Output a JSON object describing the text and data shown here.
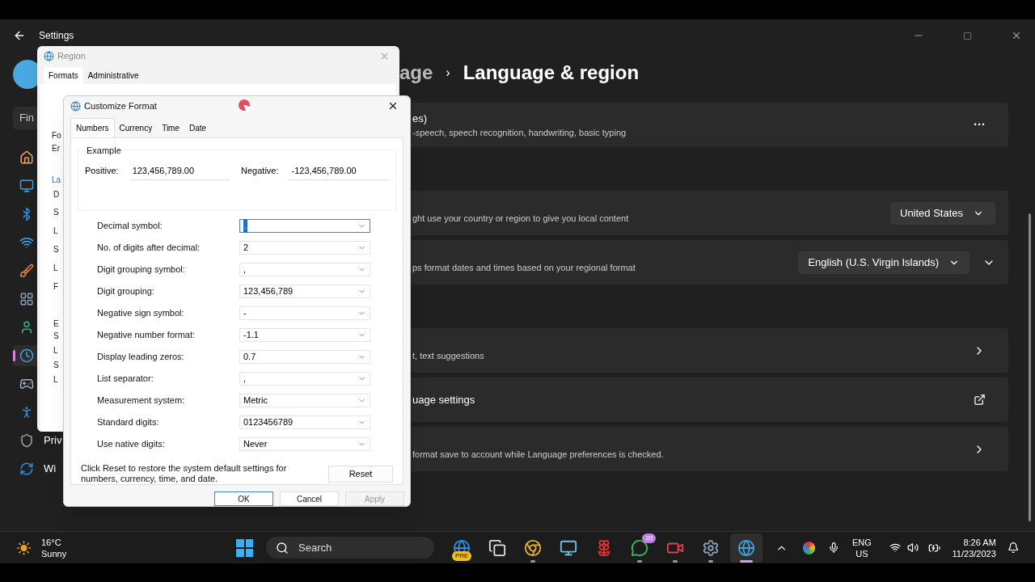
{
  "settings": {
    "title": "Settings",
    "sidebar": {
      "search": "Fin",
      "items": [
        {
          "kind": "home",
          "selected": false
        },
        {
          "kind": "system",
          "selected": false
        },
        {
          "kind": "bluetooth",
          "selected": false
        },
        {
          "kind": "network",
          "selected": false
        },
        {
          "kind": "personalization",
          "selected": false
        },
        {
          "kind": "apps",
          "selected": false
        },
        {
          "kind": "accounts",
          "selected": false
        },
        {
          "kind": "time",
          "selected": true
        },
        {
          "kind": "gaming",
          "selected": false
        },
        {
          "kind": "accessibility",
          "selected": false
        },
        {
          "kind": "privacy",
          "label": "Priv",
          "selected": false
        },
        {
          "kind": "update",
          "label": "Wi",
          "selected": false
        }
      ]
    },
    "breadcrumb": {
      "parent": "age",
      "separator": "›",
      "current": "Language & region"
    },
    "sections": [
      {
        "cards": [
          {
            "title": "es)",
            "description": "-speech, speech recognition, handwriting, basic typing",
            "action": {
              "kind": "more",
              "label": "···"
            }
          }
        ]
      },
      {
        "cards": [
          {
            "description": "ght use your country or region to give you local content",
            "action": {
              "kind": "dropdown",
              "label": "United States"
            }
          },
          {
            "description": "ps format dates and times based on your regional format",
            "action": {
              "kind": "dropdown-expand",
              "label": "English (U.S. Virgin Islands)"
            }
          }
        ]
      },
      {
        "cards": [
          {
            "description": "t, text suggestions",
            "action": {
              "kind": "chevron"
            }
          },
          {
            "title": "uage settings",
            "action": {
              "kind": "external"
            }
          },
          {
            "description": "format save to account while Language preferences is checked.",
            "action": {
              "kind": "chevron"
            }
          }
        ]
      }
    ]
  },
  "region_dialog": {
    "title": "Region",
    "tabs": [
      {
        "label": "Formats",
        "selected": true
      },
      {
        "label": "Administrative",
        "selected": false
      }
    ],
    "partial_labels": [
      {
        "text": "Fo",
        "kind": "label"
      },
      {
        "text": "Er",
        "kind": "field"
      },
      {
        "text": "La",
        "kind": "link"
      },
      {
        "text": "D",
        "kind": "label"
      },
      {
        "text": "S",
        "kind": "label"
      },
      {
        "text": "L",
        "kind": "label"
      },
      {
        "text": "S",
        "kind": "label"
      },
      {
        "text": "L",
        "kind": "label"
      },
      {
        "text": "F",
        "kind": "label"
      },
      {
        "text": "E",
        "kind": "label"
      },
      {
        "text": "S",
        "kind": "label"
      },
      {
        "text": "L",
        "kind": "label"
      },
      {
        "text": "S",
        "kind": "label"
      },
      {
        "text": "L",
        "kind": "label"
      }
    ]
  },
  "customize_dialog": {
    "title": "Customize Format",
    "tabs": [
      {
        "label": "Numbers",
        "selected": true
      },
      {
        "label": "Currency",
        "selected": false
      },
      {
        "label": "Time",
        "selected": false
      },
      {
        "label": "Date",
        "selected": false
      }
    ],
    "example": {
      "legend": "Example",
      "positive_label": "Positive:",
      "positive": "123,456,789.00",
      "negative_label": "Negative:",
      "negative": "-123,456,789.00"
    },
    "fields": [
      {
        "label": "Decimal symbol:",
        "value": ".",
        "focused": true
      },
      {
        "label": "No. of digits after decimal:",
        "value": "2",
        "focused": false
      },
      {
        "label": "Digit grouping symbol:",
        "value": ",",
        "focused": false
      },
      {
        "label": "Digit grouping:",
        "value": "123,456,789",
        "focused": false
      },
      {
        "label": "Negative sign symbol:",
        "value": "-",
        "focused": false
      },
      {
        "label": "Negative number format:",
        "value": "-1.1",
        "focused": false
      },
      {
        "label": "Display leading zeros:",
        "value": "0.7",
        "focused": false
      },
      {
        "label": "List separator:",
        "value": ",",
        "focused": false
      },
      {
        "label": "Measurement system:",
        "value": "Metric",
        "focused": false
      },
      {
        "label": "Standard digits:",
        "value": "0123456789",
        "focused": false
      },
      {
        "label": "Use native digits:",
        "value": "Never",
        "focused": false
      }
    ],
    "reset_note": "Click Reset to restore the system default settings for numbers, currency, time, and date.",
    "reset_button": "Reset",
    "buttons": [
      {
        "label": "OK",
        "default": true,
        "disabled": false
      },
      {
        "label": "Cancel",
        "default": false,
        "disabled": false
      },
      {
        "label": "Apply",
        "default": false,
        "disabled": true
      }
    ]
  },
  "taskbar": {
    "weather": {
      "temperature": "16°C",
      "condition": "Sunny"
    },
    "search_placeholder": "Search",
    "apps": [
      {
        "kind": "browser",
        "badge": "PRE",
        "running": false,
        "selected": false
      },
      {
        "kind": "taskview",
        "running": false,
        "selected": false
      },
      {
        "kind": "chrome",
        "running": true,
        "selected": false
      },
      {
        "kind": "monitor",
        "running": false,
        "selected": false
      },
      {
        "kind": "flower",
        "running": false,
        "selected": false
      },
      {
        "kind": "chat",
        "badge": "20",
        "running": true,
        "selected": false
      },
      {
        "kind": "camera",
        "running": true,
        "selected": false
      },
      {
        "kind": "settings",
        "running": true,
        "selected": false
      },
      {
        "kind": "globe-clock",
        "running": true,
        "selected": true
      }
    ],
    "language": {
      "line1": "ENG",
      "line2": "US"
    },
    "time": "8:26 AM",
    "date": "11/23/2023"
  }
}
